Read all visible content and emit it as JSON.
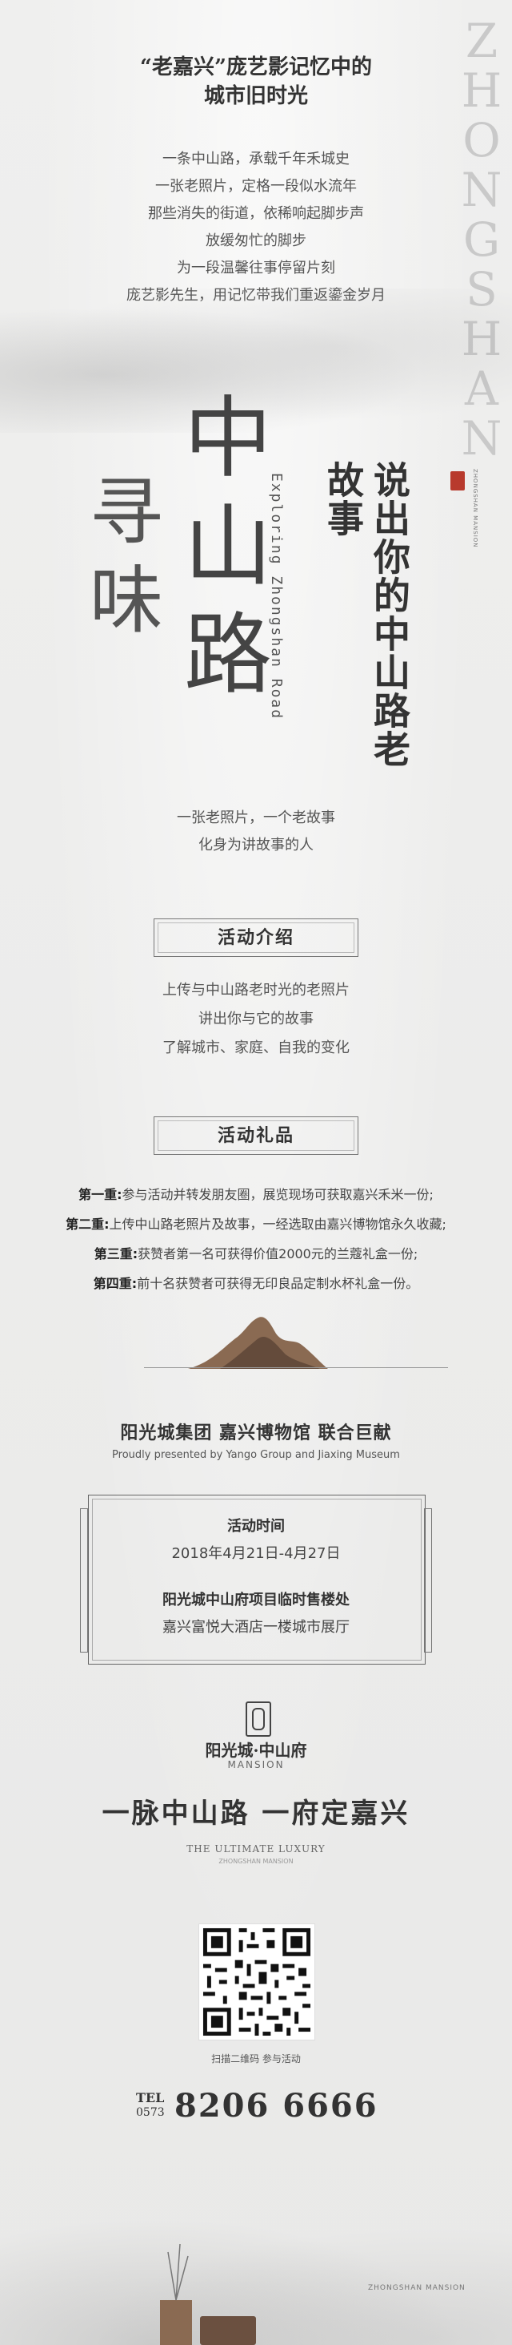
{
  "decor": {
    "vertical_letters": [
      "Z",
      "H",
      "O",
      "N",
      "G",
      "S",
      "H",
      "A",
      "N"
    ]
  },
  "headline": {
    "line1": "“老嘉兴”庞艺影记忆中的",
    "line2": "城市旧时光"
  },
  "intro": [
    "一条中山路，承载千年禾城史",
    "一张老照片，定格一段似水流年",
    "那些消失的街道，依稀响起脚步声",
    "放缓匆忙的脚步",
    "为一段温馨往事停留片刻",
    "庞艺影先生，用记忆带我们重返鎏金岁月"
  ],
  "hero": {
    "xunwei": [
      "寻",
      "味"
    ],
    "zsl": [
      "中",
      "山",
      "路"
    ],
    "english": "Exploring Zhongshan Road",
    "say": "说出你的中山路老故事",
    "tiny_vertical": "ZHONGSHAN MANSION"
  },
  "sub": [
    "一张老照片，一个老故事",
    "化身为讲故事的人"
  ],
  "section1": {
    "title": "活动介绍",
    "lines": [
      "上传与中山路老时光的老照片",
      "讲出你与它的故事",
      "了解城市、家庭、自我的变化"
    ]
  },
  "section2": {
    "title": "活动礼品",
    "gifts": [
      {
        "tier": "第一重:",
        "text": "参与活动并转发朋友圈，展览现场可获取嘉兴禾米一份;"
      },
      {
        "tier": "第二重:",
        "text": "上传中山路老照片及故事，一经选取由嘉兴博物馆永久收藏;"
      },
      {
        "tier": "第三重:",
        "text": "获赞者第一名可获得价值2000元的兰蔻礼盒一份;"
      },
      {
        "tier": "第四重:",
        "text": "前十名获赞者可获得无印良品定制水杯礼盒一份。"
      }
    ]
  },
  "organizers": {
    "cn": "阳光城集团 嘉兴博物馆 联合巨献",
    "en": "Proudly presented by Yango Group and Jiaxing Museum"
  },
  "info": {
    "time_label": "活动时间",
    "time_value": "2018年4月21日-4月27日",
    "place_label": "阳光城中山府项目临时售楼处",
    "place_value": "嘉兴富悦大酒店一楼城市展厅"
  },
  "brand": {
    "name": "阳光城·中山府",
    "name_en": "MANSION",
    "slogan": "一脉中山路  一府定嘉兴",
    "ultimate": "THE ULTIMATE LUXURY",
    "ultimate_sub": "ZHONGSHAN MANSION",
    "qr_caption": "扫描二维码 参与活动"
  },
  "contact": {
    "label": "TEL",
    "code": "0573",
    "number": "8206 6666"
  },
  "footer": {
    "mark": "ZHONGSHAN MANSION"
  },
  "colors": {
    "background": "#ebebea",
    "text": "#333333",
    "seal": "#b83a2d",
    "bronze": "#8a6a52"
  }
}
